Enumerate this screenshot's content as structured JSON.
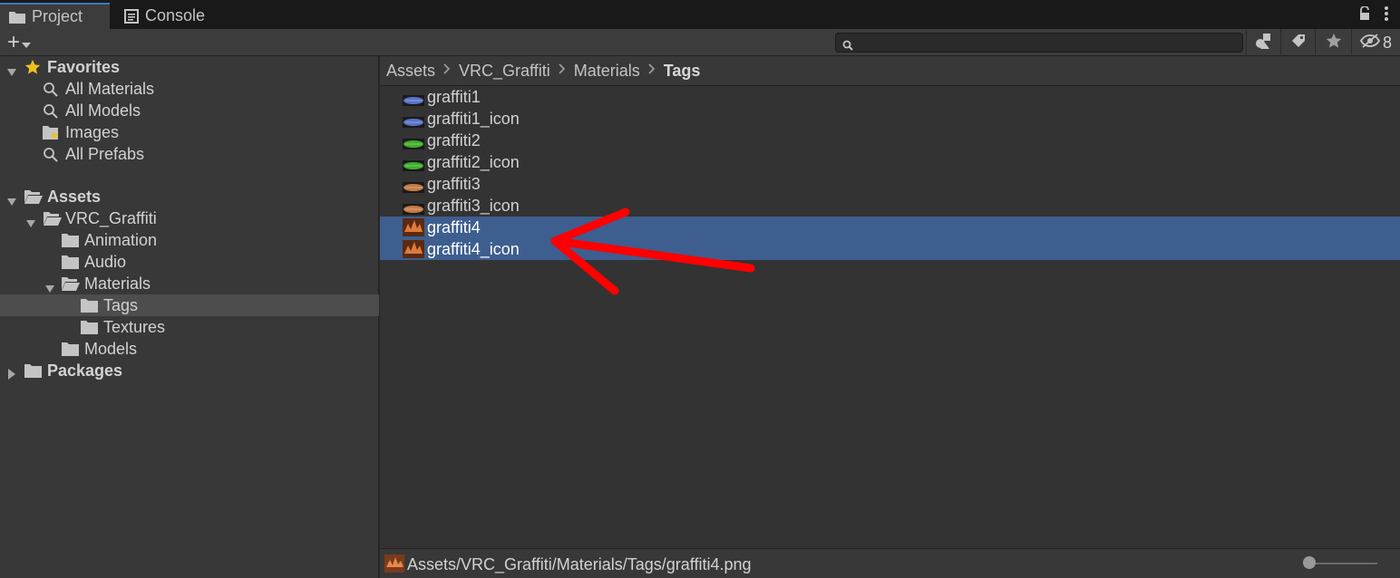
{
  "tabs": [
    {
      "label": "Project",
      "active": true
    },
    {
      "label": "Console",
      "active": false
    }
  ],
  "toolbar": {
    "create_symbol": "+",
    "search_value": "",
    "hidden_packages_count": "8"
  },
  "tree": {
    "favorites": {
      "label": "Favorites",
      "items": [
        "All Materials",
        "All Models",
        "Images",
        "All Prefabs"
      ]
    },
    "assets": {
      "label": "Assets",
      "vrc": "VRC_Graffiti",
      "animation": "Animation",
      "audio": "Audio",
      "materials": "Materials",
      "tags": "Tags",
      "textures": "Textures",
      "models": "Models"
    },
    "packages": "Packages",
    "selected": "Tags"
  },
  "breadcrumb": [
    "Assets",
    "VRC_Graffiti",
    "Materials",
    "Tags"
  ],
  "assets": [
    {
      "name": "graffiti1",
      "color": "#5a73c8",
      "selected": false
    },
    {
      "name": "graffiti1_icon",
      "color": "#5a73c8",
      "selected": false
    },
    {
      "name": "graffiti2",
      "color": "#3fae2a",
      "selected": false
    },
    {
      "name": "graffiti2_icon",
      "color": "#3fae2a",
      "selected": false
    },
    {
      "name": "graffiti3",
      "color": "#c57a45",
      "selected": false
    },
    {
      "name": "graffiti3_icon",
      "color": "#c57a45",
      "selected": false
    },
    {
      "name": "graffiti4",
      "color": "#e07a3a",
      "selected": true
    },
    {
      "name": "graffiti4_icon",
      "color": "#e07a3a",
      "selected": true
    }
  ],
  "status": {
    "path": "Assets/VRC_Graffiti/Materials/Tags/graffiti4.png",
    "zoom_fraction": 0.0
  },
  "colors": {
    "selection": "#3d5e8f",
    "annotation_arrow": "#ff0000",
    "favorite_star": "#f0c020"
  }
}
